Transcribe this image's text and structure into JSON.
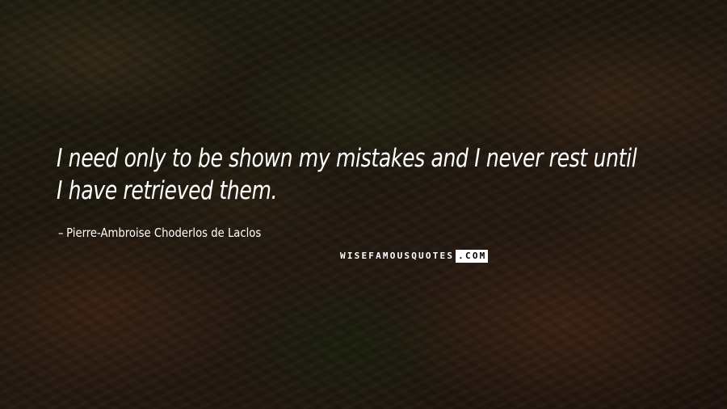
{
  "quote": {
    "text": "I need only to be shown my mistakes and I never rest until I have retrieved them."
  },
  "attribution": {
    "dash": "–",
    "author": "Pierre-Ambroise Choderlos de Laclos"
  },
  "watermark": {
    "main": "WISEFAMOUSQUOTES",
    "suffix": ".COM"
  },
  "colors": {
    "text": "#ffffff",
    "background_tone": "#2a2315"
  }
}
